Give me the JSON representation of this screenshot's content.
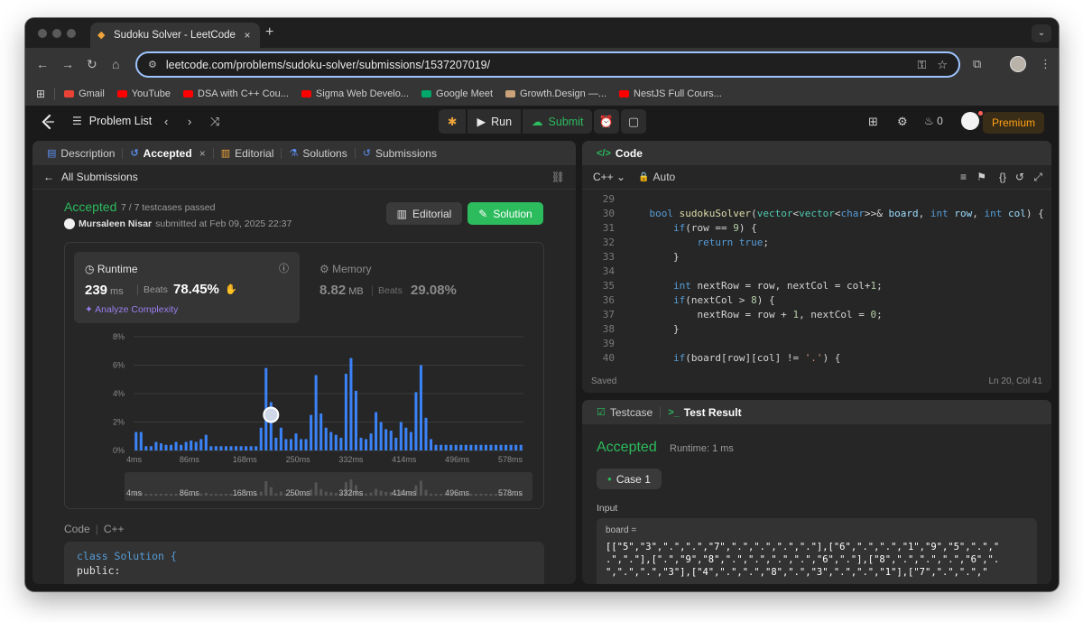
{
  "browser": {
    "tab_title": "Sudoku Solver - LeetCode",
    "tab_close": "×",
    "new_tab": "+",
    "url": "leetcode.com/problems/sudoku-solver/submissions/1537207019/",
    "bookmarks": [
      {
        "label": "Gmail",
        "color": "#ea4335"
      },
      {
        "label": "YouTube",
        "color": "#ff0000"
      },
      {
        "label": "DSA with C++ Cou...",
        "color": "#ff0000"
      },
      {
        "label": "Sigma Web Develo...",
        "color": "#ff0000"
      },
      {
        "label": "Google Meet",
        "color": "#00a86b"
      },
      {
        "label": "Growth.Design —...",
        "color": "#c9a27a"
      },
      {
        "label": "NestJS Full Cours...",
        "color": "#ff0000"
      }
    ]
  },
  "header": {
    "problem_list": "Problem List",
    "run": "Run",
    "submit": "Submit",
    "streak": "0",
    "premium": "Premium"
  },
  "left_panel": {
    "tabs": {
      "description": "Description",
      "accepted": "Accepted",
      "editorial": "Editorial",
      "solutions": "Solutions",
      "submissions": "Submissions"
    },
    "back_label": "All Submissions",
    "status": "Accepted",
    "testcases": "7 / 7 testcases passed",
    "user": "Mursaleen Nisar",
    "submitted_at": "submitted at Feb 09, 2025 22:37",
    "editorial_btn": "Editorial",
    "solution_btn": "Solution",
    "runtime": {
      "title": "Runtime",
      "value": "239",
      "unit": "ms",
      "beats_label": "Beats",
      "beats_pct": "78.45%",
      "analyze": "Analyze Complexity"
    },
    "memory": {
      "title": "Memory",
      "value": "8.82",
      "unit": "MB",
      "beats_label": "Beats",
      "beats_pct": "29.08%"
    },
    "code_label": "Code",
    "code_lang": "C++",
    "code_lines": [
      "class Solution {",
      "public:"
    ]
  },
  "chart_data": {
    "type": "bar",
    "x_ticks": [
      "4ms",
      "86ms",
      "168ms",
      "250ms",
      "332ms",
      "414ms",
      "496ms",
      "578ms"
    ],
    "y_ticks": [
      "8%",
      "6%",
      "4%",
      "2%",
      "0%"
    ],
    "ylim": [
      0,
      8
    ],
    "highlight_index": 27,
    "values": [
      1.3,
      1.3,
      0.3,
      0.3,
      0.6,
      0.5,
      0.4,
      0.4,
      0.6,
      0.4,
      0.6,
      0.7,
      0.6,
      0.8,
      1.1,
      0.3,
      0.3,
      0.3,
      0.3,
      0.3,
      0.3,
      0.3,
      0.3,
      0.3,
      0.3,
      1.6,
      5.8,
      3.4,
      0.9,
      1.6,
      0.8,
      0.8,
      1.2,
      0.8,
      0.8,
      2.5,
      5.3,
      2.6,
      1.6,
      1.3,
      1.1,
      0.9,
      5.4,
      6.5,
      4.2,
      0.9,
      0.8,
      1.2,
      2.7,
      2.0,
      1.5,
      1.4,
      0.9,
      2.0,
      1.6,
      1.3,
      4.1,
      6.0,
      2.3,
      0.8,
      0.4,
      0.4,
      0.4,
      0.4,
      0.4,
      0.4,
      0.4,
      0.4,
      0.4,
      0.4,
      0.4,
      0.4,
      0.4,
      0.4,
      0.4,
      0.4,
      0.4,
      0.4
    ]
  },
  "code_panel": {
    "title": "Code",
    "lang": "C++",
    "mode": "Auto",
    "saved": "Saved",
    "position": "Ln 20, Col 41",
    "line_numbers": [
      "29",
      "30",
      "31",
      "32",
      "33",
      "34",
      "35",
      "36",
      "37",
      "38",
      "39",
      "40"
    ]
  },
  "result_panel": {
    "tab_testcase": "Testcase",
    "tab_result": "Test Result",
    "status": "Accepted",
    "runtime": "Runtime: 1 ms",
    "case": "Case 1",
    "input_label": "Input",
    "board_label": "board =",
    "board_lines": [
      "[[\"5\",\"3\",\".\",\".\",\"7\",\".\",\".\",\".\",\".\"],[\"6\",\".\",\".\",\"1\",\"9\",\"5\",\".\",\"",
      ".\",\".\"],[\".\",\"9\",\"8\",\".\",\".\",\".\",\".\",\"6\",\".\"],[\"8\",\".\",\".\",\".\",\"6\",\".",
      "\",\".\",\".\",\"3\"],[\"4\",\".\",\".\",\"8\",\".\",\"3\",\".\",\".\",\"1\"],[\"7\",\".\",\".\",\""
    ]
  }
}
